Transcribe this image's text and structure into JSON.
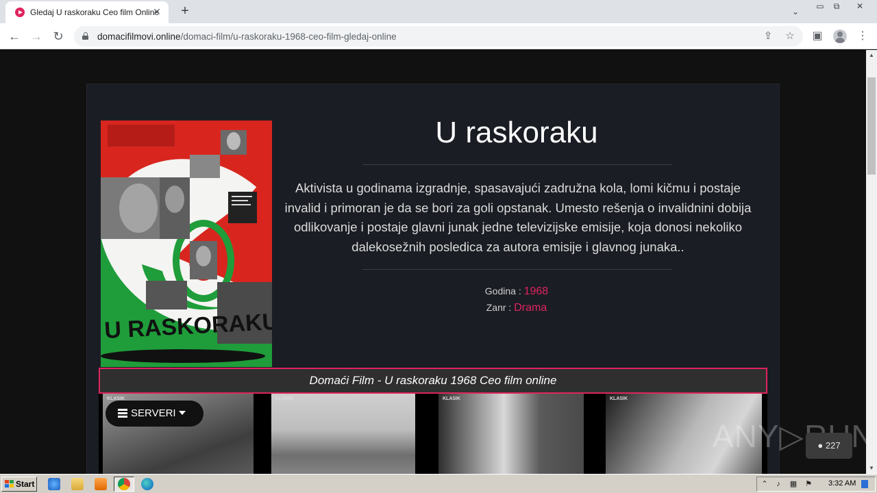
{
  "browser": {
    "tab_title": "Gledaj U raskoraku Ceo film Online",
    "tab_close": "✕",
    "new_tab": "+",
    "tab_search": "⌄",
    "window_controls": {
      "minimize": "▭",
      "restore": "⧉",
      "close": "✕"
    },
    "url_host": "domacifilmovi.online",
    "url_path": "/domaci-film/u-raskoraku-1968-ceo-film-gledaj-online",
    "icons": {
      "back": "←",
      "forward": "→",
      "reload": "↻",
      "share": "⇪",
      "bookmark": "☆",
      "sidebar": "▣",
      "menu": "⋮"
    }
  },
  "page": {
    "poster_title": "U RASKORAKU",
    "title": "U raskoraku",
    "description": "Aktivista u godinama izgradnje, spasavajući zadružna kola, lomi kičmu i postaje invalid i primoran je da se bori za goli opstanak. Umesto rešenja o invalidnini dobija odlikovanje i postaje glavni junak jedne televizijske emisije, koja donosi nekoliko dalekosežnih posledica za autora emisije i glavnog junaka..",
    "year_label": "Godina :",
    "year_value": "1968",
    "genre_label": "Zanr :",
    "genre_value": "Drama",
    "banner": "Domaći Film - U raskoraku 1968 Ceo film online",
    "servers_button": "SERVERI",
    "still_label": "KLASIK",
    "watermark": "ANY▷RUN",
    "viewers": "227"
  },
  "taskbar": {
    "start": "Start",
    "clock": "3:32 AM"
  },
  "colors": {
    "accent": "#e0245e",
    "card_bg": "#1b1d24",
    "page_bg": "#111111"
  }
}
